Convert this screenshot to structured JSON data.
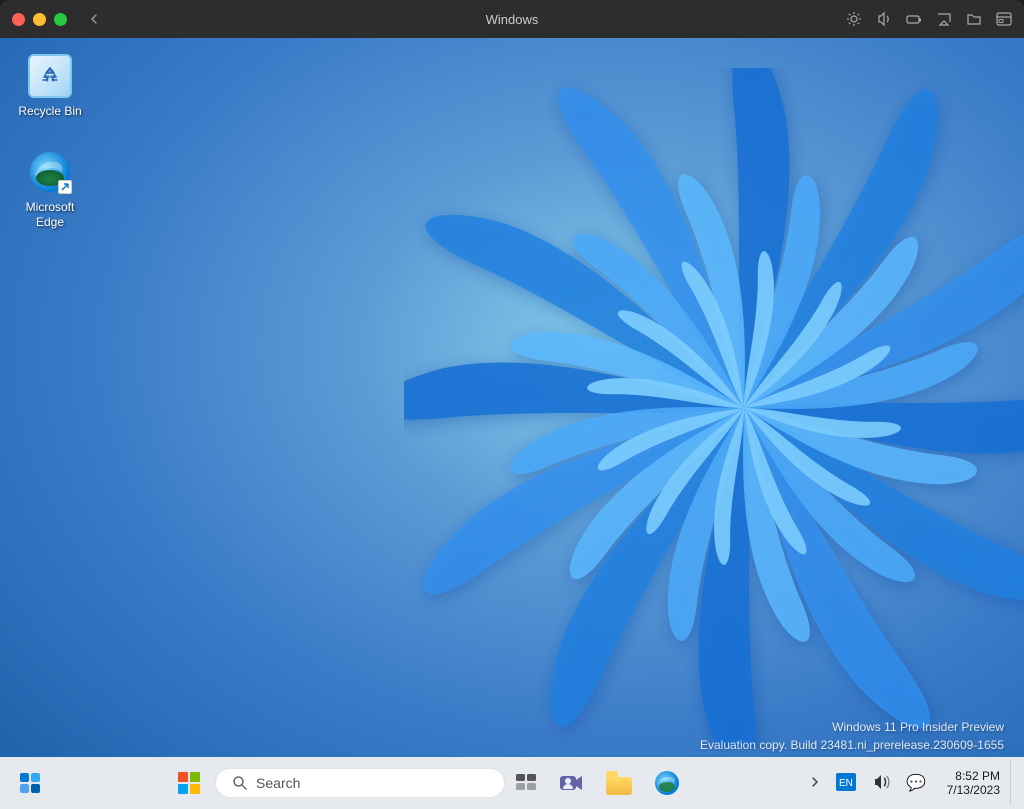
{
  "window": {
    "title": "Windows",
    "buttons": {
      "close": "close",
      "minimize": "minimize",
      "maximize": "maximize"
    }
  },
  "desktop": {
    "icons": [
      {
        "id": "recycle-bin",
        "label": "Recycle Bin",
        "type": "recycle-bin"
      },
      {
        "id": "microsoft-edge",
        "label": "Microsoft Edge",
        "type": "edge"
      }
    ],
    "watermark": {
      "line1": "Windows 11 Pro Insider Preview",
      "line2": "Evaluation copy. Build 23481.ni_prerelease.230609-1655"
    }
  },
  "taskbar": {
    "search_placeholder": "Search",
    "search_label": "Search",
    "clock": {
      "time": "8:52 PM",
      "date": "7/13/2023"
    },
    "pinned_apps": [
      {
        "id": "task-view",
        "label": "Task View"
      },
      {
        "id": "meet-now",
        "label": "Meet Now"
      },
      {
        "id": "file-explorer",
        "label": "File Explorer"
      },
      {
        "id": "edge",
        "label": "Microsoft Edge"
      }
    ],
    "tray_icons": [
      {
        "id": "chevron",
        "label": "Show hidden icons"
      },
      {
        "id": "language",
        "label": "Language"
      },
      {
        "id": "volume",
        "label": "Volume"
      },
      {
        "id": "notifications",
        "label": "Notifications"
      }
    ]
  }
}
